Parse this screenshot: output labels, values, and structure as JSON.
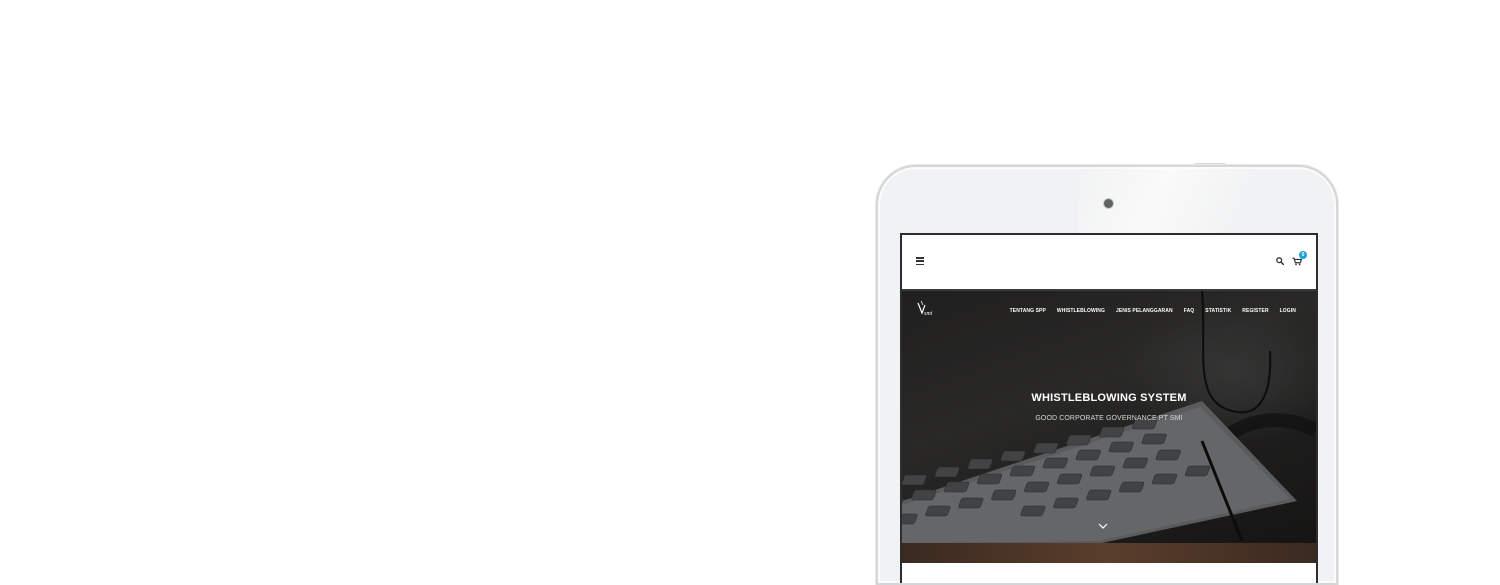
{
  "device": {
    "type": "tablet"
  },
  "toolbar": {
    "menu_icon": "hamburger-icon",
    "search_icon": "search-icon",
    "cart_icon": "shopping-cart-icon",
    "cart_count": "0",
    "badge_color": "#1ba1d6"
  },
  "site": {
    "logo_alt": "logo",
    "nav": [
      {
        "label": "TENTANG SPP"
      },
      {
        "label": "WHISTLEBLOWING"
      },
      {
        "label": "JENIS PELANGGARAN"
      },
      {
        "label": "FAQ"
      },
      {
        "label": "STATISTIK"
      },
      {
        "label": "REGISTER"
      },
      {
        "label": "LOGIN"
      }
    ]
  },
  "hero": {
    "title": "WHISTLEBLOWING SYSTEM",
    "subtitle": "GOOD CORPORATE GOVERNANCE PT SMI",
    "scroll_icon": "chevron-down-icon"
  }
}
